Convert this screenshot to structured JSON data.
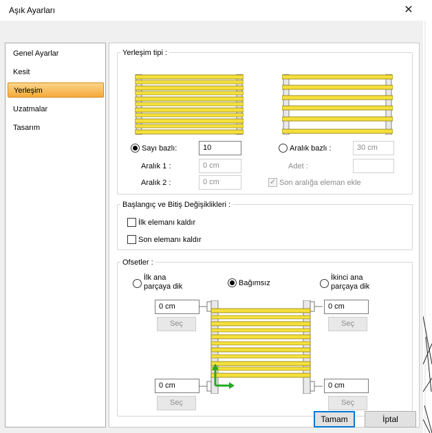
{
  "window": {
    "title": "Aşık Ayarları"
  },
  "nav": {
    "items": [
      {
        "label": "Genel Ayarlar"
      },
      {
        "label": "Kesit"
      },
      {
        "label": "Yerleşim",
        "selected": true
      },
      {
        "label": "Uzatmalar"
      },
      {
        "label": "Tasarım"
      }
    ]
  },
  "placement": {
    "title": "Yerleşim tipi :",
    "count_based": {
      "label": "Sayı bazlı:",
      "value": "10",
      "selected": true
    },
    "spacing1": {
      "label": "Aralık 1 :",
      "value": "0 cm"
    },
    "spacing2": {
      "label": "Aralık 2 :",
      "value": "0 cm"
    },
    "spacing_based": {
      "label": "Aralık bazlı :",
      "value": "30 cm",
      "selected": false
    },
    "count": {
      "label": "Adet :",
      "value": ""
    },
    "add_last": {
      "label": "Son aralığa eleman ekle",
      "checked": true
    }
  },
  "endchanges": {
    "title": "Başlangıç ve Bitiş Değişiklikleri :",
    "remove_first": {
      "label": "İlk elemanı kaldır",
      "checked": false
    },
    "remove_last": {
      "label": "Son elemanı kaldır",
      "checked": false
    }
  },
  "offsets": {
    "title": "Ofsetler :",
    "first_perp": {
      "line1": "İlk ana",
      "line2": "parçaya dik",
      "selected": false
    },
    "independent": {
      "label": "Bağımsız",
      "selected": true
    },
    "second_perp": {
      "line1": "İkinci ana",
      "line2": "parçaya dik",
      "selected": false
    },
    "top_left": {
      "value": "0 cm",
      "select_label": "Seç"
    },
    "top_right": {
      "value": "0 cm",
      "select_label": "Seç"
    },
    "bottom_left": {
      "value": "0 cm",
      "select_label": "Seç"
    },
    "bottom_right": {
      "value": "0 cm",
      "select_label": "Seç"
    }
  },
  "buttons": {
    "ok": "Tamam",
    "cancel": "İptal"
  },
  "colors": {
    "purlin_yellow": "#f5e03c",
    "purlin_border": "#8a7a10",
    "selected_orange": "#f5a93b",
    "arrow_green": "#22aa22"
  }
}
